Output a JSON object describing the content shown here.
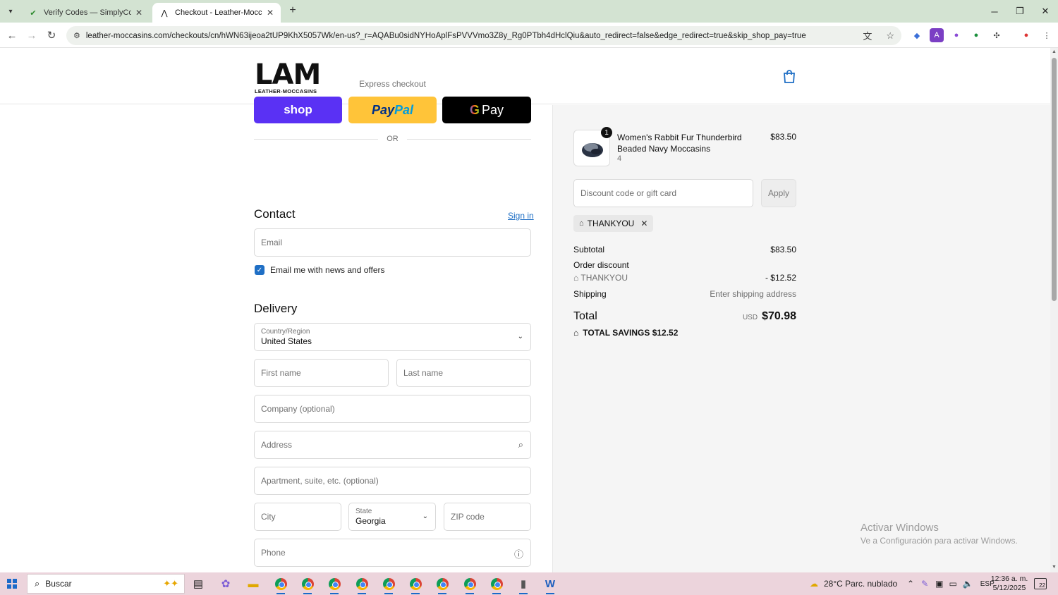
{
  "browser": {
    "tabs": [
      {
        "title": "Verify Codes — SimplyCodes",
        "icon": "simplycodes-icon"
      },
      {
        "title": "Checkout - Leather-Moccasins",
        "icon": "lm-icon"
      }
    ],
    "url": "leather-moccasins.com/checkouts/cn/hWN63ijeoa2tUP9KhX5057Wk/en-us?_r=AQABu0sidNYHoAplFsPVVVmo3Z8y_Rg0PTbh4dHclQiu&auto_redirect=false&edge_redirect=true&skip_shop_pay=true",
    "url_domain": "leather-moccasins.com"
  },
  "header": {
    "logo_big": "LAM",
    "logo_small": "LEATHER-MOCCASINS"
  },
  "express": {
    "label": "Express checkout",
    "shop_label": "shop",
    "paypal_label_1": "Pay",
    "paypal_label_2": "Pal",
    "gpay_g": "G",
    "gpay_label": "Pay",
    "or_label": "OR"
  },
  "contact": {
    "title": "Contact",
    "signin_label": "Sign in",
    "email_placeholder": "Email",
    "newsletter_label": "Email me with news and offers",
    "newsletter_checked": true
  },
  "delivery": {
    "title": "Delivery",
    "country_label": "Country/Region",
    "country_value": "United States",
    "first_name_placeholder": "First name",
    "last_name_placeholder": "Last name",
    "company_placeholder": "Company (optional)",
    "address_placeholder": "Address",
    "apartment_placeholder": "Apartment, suite, etc. (optional)",
    "city_placeholder": "City",
    "state_label": "State",
    "state_value": "Georgia",
    "zip_placeholder": "ZIP code",
    "phone_placeholder": "Phone"
  },
  "summary": {
    "product": {
      "quantity": "1",
      "name": "Women's Rabbit Fur Thunderbird Beaded Navy Moccasins",
      "variant": "4",
      "price": "$83.50"
    },
    "discount_placeholder": "Discount code or gift card",
    "apply_label": "Apply",
    "applied_code": "THANKYOU",
    "subtotal_label": "Subtotal",
    "subtotal_value": "$83.50",
    "order_discount_label": "Order discount",
    "discount_code": "THANKYOU",
    "discount_value": "- $12.52",
    "shipping_label": "Shipping",
    "shipping_value": "Enter shipping address",
    "total_label": "Total",
    "total_currency": "USD",
    "total_value": "$70.98",
    "savings_label": "TOTAL SAVINGS $12.52"
  },
  "watermark": {
    "line1": "Activar Windows",
    "line2": "Ve a Configuración para activar Windows."
  },
  "taskbar": {
    "search_label": "Buscar",
    "weather": "28°C  Parc. nublado",
    "language": "ESP",
    "time": "12:36 a. m.",
    "date": "5/12/2025",
    "notifications": "22"
  },
  "colors": {
    "shop": "#5a31f4",
    "paypal": "#ffc439",
    "link": "#1f6fc5",
    "tabbar": "#d3e3d2",
    "taskbar": "#ecd4dc"
  }
}
